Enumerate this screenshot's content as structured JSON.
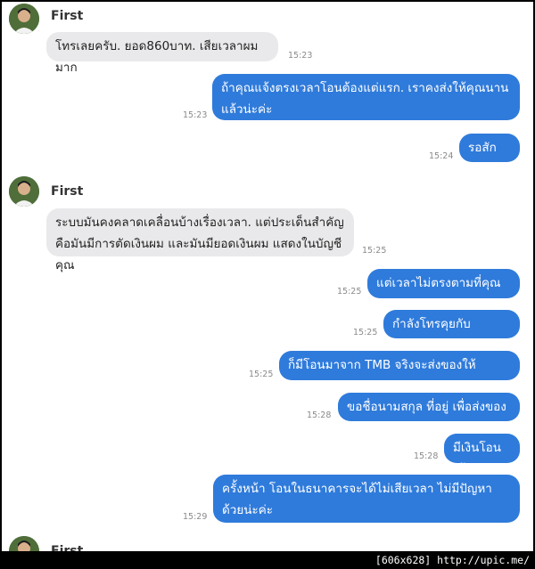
{
  "messages": [
    {
      "sender": "First",
      "text": "โทรเลยครับ. ยอด860บาท. เสียเวลาผมมาก",
      "time": "15:23"
    },
    {
      "text": "ถ้าคุณแจ้งตรงเวลาโอนต้องแต่แรก. เราคงส่งให้คุณนานแล้วน่ะค่ะ",
      "time": "15:23"
    },
    {
      "text": "รอสักครู่",
      "time": "15:24"
    },
    {
      "sender": "First",
      "text": "ระบบมันคงคลาดเคลื่อนบ้างเรื่องเวลา. แต่ประเด็นสำคัญคือมันมีการตัดเงินผม และมันมียอดเงินผม แสดงในบัญชีคุณ",
      "time": "15:25"
    },
    {
      "text": "แต่เวลาไม่ตรงตามที่คุณบอก",
      "time": "15:25"
    },
    {
      "text": "กำลังโทรคุยกับพนักงาน",
      "time": "15:25"
    },
    {
      "text": "ก็มีโอนมาจาก TMB จริงจะส่งของให้แน่นอนค่ะ",
      "time": "15:25"
    },
    {
      "text": "ขอชื่อนามสกุล ที่อยู่ เพื่อส่งของค่ะ",
      "time": "15:28"
    },
    {
      "text": "มีเงินโอนเข้า",
      "time": "15:28"
    },
    {
      "text": "ครั้งหน้า โอนในธนาคารจะได้ไม่เสียเวลา ไม่มีปัญหาด้วยน่ะค่ะ",
      "time": "15:29"
    },
    {
      "sender": "First"
    }
  ],
  "footer": {
    "text": "[606x628] http://upic.me/"
  }
}
